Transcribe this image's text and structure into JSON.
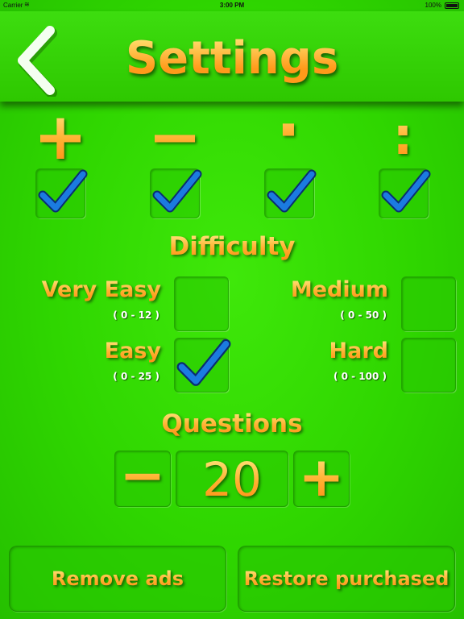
{
  "status_bar": {
    "carrier": "Carrier",
    "time": "3:00 PM",
    "battery": "100%"
  },
  "header": {
    "title": "Settings",
    "back_icon": "chevron-left-icon"
  },
  "operations": [
    {
      "symbol": "+",
      "name": "addition",
      "checked": true
    },
    {
      "symbol": "−",
      "name": "subtraction",
      "checked": true
    },
    {
      "symbol": "·",
      "name": "multiplication",
      "checked": true
    },
    {
      "symbol": ":",
      "name": "division",
      "checked": true
    }
  ],
  "difficulty": {
    "heading": "Difficulty",
    "levels": [
      {
        "name": "Very Easy",
        "range": "( 0 - 12 )",
        "checked": false
      },
      {
        "name": "Medium",
        "range": "( 0 - 50 )",
        "checked": false
      },
      {
        "name": "Easy",
        "range": "( 0 - 25 )",
        "checked": true
      },
      {
        "name": "Hard",
        "range": "( 0 - 100 )",
        "checked": false
      }
    ]
  },
  "questions": {
    "heading": "Questions",
    "minus_label": "−",
    "value": "20",
    "plus_label": "+"
  },
  "buttons": {
    "remove_ads": "Remove ads",
    "restore_purchased": "Restore purchased"
  },
  "colors": {
    "background": "#2fd600",
    "accent_orange": "#ff9c1c",
    "checkmark_blue": "#1a6fd0"
  }
}
